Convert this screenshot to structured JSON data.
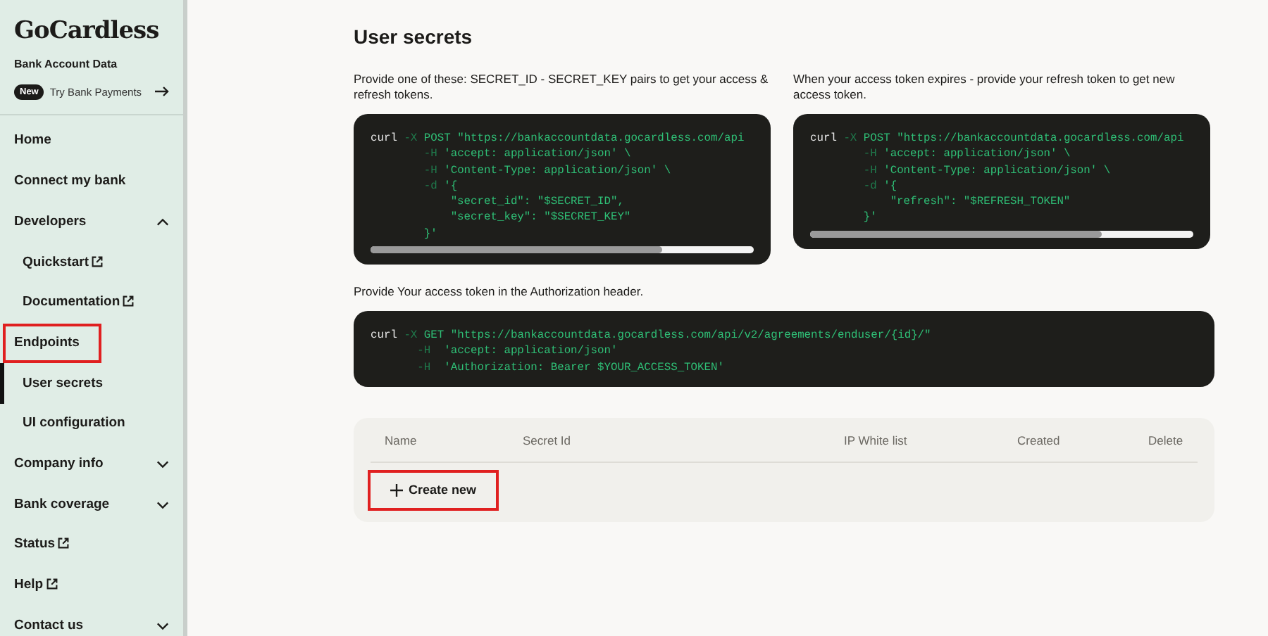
{
  "sidebar": {
    "logo": "GoCardless",
    "subtitle": "Bank Account Data",
    "promo": {
      "badge": "New",
      "text": "Try Bank Payments"
    },
    "items": [
      {
        "label": "Home",
        "kind": "link",
        "selected": false,
        "highlighted": false
      },
      {
        "label": "Connect my bank",
        "kind": "link",
        "selected": false,
        "highlighted": false
      },
      {
        "label": "Developers",
        "kind": "group",
        "expanded": true,
        "selected": false,
        "highlighted": false,
        "children": [
          {
            "label": "Quickstart",
            "kind": "external",
            "selected": false,
            "highlighted": false
          },
          {
            "label": "Documentation",
            "kind": "external",
            "selected": false,
            "highlighted": false
          },
          {
            "label": "Endpoints",
            "kind": "link",
            "selected": false,
            "highlighted": true
          },
          {
            "label": "User secrets",
            "kind": "link",
            "selected": true,
            "highlighted": false
          },
          {
            "label": "UI configuration",
            "kind": "link",
            "selected": false,
            "highlighted": false
          }
        ]
      },
      {
        "label": "Company info",
        "kind": "group",
        "expanded": false,
        "selected": false,
        "highlighted": false
      },
      {
        "label": "Bank coverage",
        "kind": "group",
        "expanded": false,
        "selected": false,
        "highlighted": false
      },
      {
        "label": "Status",
        "kind": "external",
        "selected": false,
        "highlighted": false
      },
      {
        "label": "Help",
        "kind": "external",
        "selected": false,
        "highlighted": false
      },
      {
        "label": "Contact us",
        "kind": "group",
        "expanded": false,
        "selected": false,
        "highlighted": false
      }
    ]
  },
  "page": {
    "title": "User secrets",
    "snippets": [
      {
        "description": "Provide one of these: SECRET_ID - SECRET_KEY pairs to get your access & refresh tokens.",
        "scrollable": true,
        "lines": [
          [
            {
              "kind": "cmd",
              "text": "curl "
            },
            {
              "kind": "flag",
              "text": "-X "
            },
            {
              "kind": "str",
              "text": "POST \"https://bankaccountdata.gocardless.com/api"
            }
          ],
          [
            {
              "kind": "flag",
              "text": "        -H "
            },
            {
              "kind": "str",
              "text": "'accept: application/json' \\"
            }
          ],
          [
            {
              "kind": "flag",
              "text": "        -H "
            },
            {
              "kind": "str",
              "text": "'Content-Type: application/json' \\"
            }
          ],
          [
            {
              "kind": "flag",
              "text": "        -d "
            },
            {
              "kind": "str",
              "text": "'{"
            }
          ],
          [
            {
              "kind": "str",
              "text": "            \"secret_id\": \"$SECRET_ID\","
            }
          ],
          [
            {
              "kind": "str",
              "text": "            \"secret_key\": \"$SECRET_KEY\""
            }
          ],
          [
            {
              "kind": "str",
              "text": "        }'"
            }
          ]
        ]
      },
      {
        "description": "When your access token expires - provide your refresh token to get new access token.",
        "scrollable": true,
        "lines": [
          [
            {
              "kind": "cmd",
              "text": "curl "
            },
            {
              "kind": "flag",
              "text": "-X "
            },
            {
              "kind": "str",
              "text": "POST \"https://bankaccountdata.gocardless.com/api"
            }
          ],
          [
            {
              "kind": "flag",
              "text": "        -H "
            },
            {
              "kind": "str",
              "text": "'accept: application/json' \\"
            }
          ],
          [
            {
              "kind": "flag",
              "text": "        -H "
            },
            {
              "kind": "str",
              "text": "'Content-Type: application/json' \\"
            }
          ],
          [
            {
              "kind": "flag",
              "text": "        -d "
            },
            {
              "kind": "str",
              "text": "'{"
            }
          ],
          [
            {
              "kind": "str",
              "text": "            \"refresh\": \"$REFRESH_TOKEN\""
            }
          ],
          [
            {
              "kind": "str",
              "text": "        }'"
            }
          ]
        ]
      },
      {
        "description": "Provide Your access token in the Authorization header.",
        "scrollable": false,
        "lines": [
          [
            {
              "kind": "cmd",
              "text": "curl "
            },
            {
              "kind": "flag",
              "text": "-X "
            },
            {
              "kind": "str",
              "text": "GET \"https://bankaccountdata.gocardless.com/api/v2/agreements/enduser/{id}/\""
            }
          ],
          [
            {
              "kind": "flag",
              "text": "       -H  "
            },
            {
              "kind": "str",
              "text": "'accept: application/json'"
            }
          ],
          [
            {
              "kind": "flag",
              "text": "       -H  "
            },
            {
              "kind": "str",
              "text": "'Authorization: Bearer $YOUR_ACCESS_TOKEN'"
            }
          ]
        ]
      }
    ],
    "table": {
      "columns": [
        "Name",
        "Secret Id",
        "IP White list",
        "Created",
        "Delete"
      ],
      "create_button": {
        "label": "Create new",
        "highlighted": true
      }
    }
  }
}
